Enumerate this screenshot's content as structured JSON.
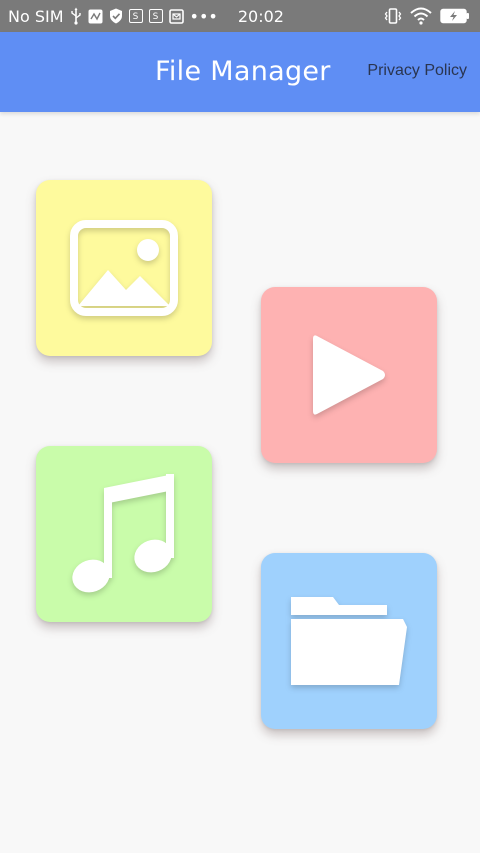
{
  "status_bar": {
    "carrier": "No SIM",
    "time": "20:02",
    "notification_icons": [
      "usb-icon",
      "notification-box-icon",
      "shield-icon",
      "s-app-icon",
      "s-app-icon",
      "mail-box-icon",
      "more-dots-icon"
    ],
    "system_icons": [
      "vibrate-icon",
      "wifi-icon",
      "battery-charging-icon"
    ],
    "s_label": "S",
    "more": "•••",
    "colors": {
      "background": "#7a7a7a",
      "text": "#ffffff"
    }
  },
  "app_bar": {
    "title": "File Manager",
    "privacy_link": "Privacy Policy",
    "colors": {
      "background": "#5f8ef4",
      "title": "#ffffff",
      "link": "#2a3550"
    }
  },
  "tiles": [
    {
      "id": "images",
      "icon": "image-icon",
      "color": "#fefa9d"
    },
    {
      "id": "videos",
      "icon": "play-icon",
      "color": "#feb2b2"
    },
    {
      "id": "music",
      "icon": "music-note-icon",
      "color": "#c9fcaa"
    },
    {
      "id": "files",
      "icon": "folder-icon",
      "color": "#9fd1fd"
    }
  ],
  "colors": {
    "page_background": "#f8f8f8",
    "icon_fill": "#ffffff"
  }
}
